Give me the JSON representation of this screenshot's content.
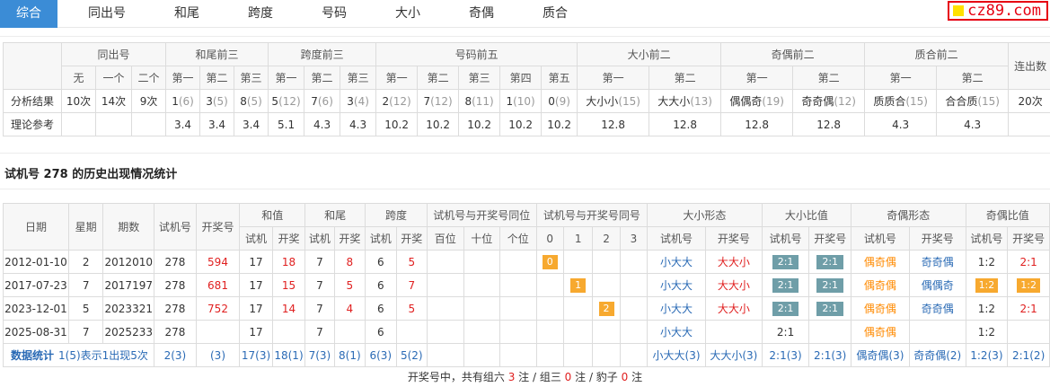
{
  "tabs": [
    "综合",
    "同出号",
    "和尾",
    "跨度",
    "号码",
    "大小",
    "奇偶",
    "质合"
  ],
  "logo": "cz89.com",
  "t1": {
    "groups": [
      "同出号",
      "和尾前三",
      "跨度前三",
      "号码前五",
      "大小前二",
      "奇偶前二",
      "质合前二",
      "连出数"
    ],
    "sub": [
      "无",
      "一个",
      "二个",
      "第一",
      "第二",
      "第三",
      "第一",
      "第二",
      "第三",
      "第一",
      "第二",
      "第三",
      "第四",
      "第五",
      "第一",
      "第二",
      "第一",
      "第二",
      "第一",
      "第二"
    ],
    "row1_label": "分析结果",
    "row1": [
      [
        "10次",
        ""
      ],
      [
        "14次",
        ""
      ],
      [
        "9次",
        ""
      ],
      [
        "1",
        "(6)"
      ],
      [
        "3",
        "(5)"
      ],
      [
        "8",
        "(5)"
      ],
      [
        "5",
        "(12)"
      ],
      [
        "7",
        "(6)"
      ],
      [
        "3",
        "(4)"
      ],
      [
        "2",
        "(12)"
      ],
      [
        "7",
        "(12)"
      ],
      [
        "8",
        "(11)"
      ],
      [
        "1",
        "(10)"
      ],
      [
        "0",
        "(9)"
      ],
      [
        "大小小",
        "(15)"
      ],
      [
        "大大小",
        "(13)"
      ],
      [
        "偶偶奇",
        "(19)"
      ],
      [
        "奇奇偶",
        "(12)"
      ],
      [
        "质质合",
        "(15)"
      ],
      [
        "合合质",
        "(15)"
      ],
      [
        "20次",
        ""
      ]
    ],
    "row2_label": "理论参考",
    "row2": [
      "",
      "",
      "",
      "3.4",
      "3.4",
      "3.4",
      "5.1",
      "4.3",
      "4.3",
      "10.2",
      "10.2",
      "10.2",
      "10.2",
      "10.2",
      "12.8",
      "12.8",
      "12.8",
      "12.8",
      "4.3",
      "4.3",
      ""
    ]
  },
  "section_title": "试机号 278 的历史出现情况统计",
  "t2": {
    "h1": [
      "日期",
      "星期",
      "期数",
      "试机号",
      "开奖号",
      "和值",
      "和尾",
      "跨度",
      "试机号与开奖号同位",
      "试机号与开奖号同号",
      "大小形态",
      "大小比值",
      "奇偶形态",
      "奇偶比值"
    ],
    "h2": [
      "试机",
      "开奖",
      "试机",
      "开奖",
      "试机",
      "开奖",
      "百位",
      "十位",
      "个位",
      "0",
      "1",
      "2",
      "3",
      "试机号",
      "开奖号",
      "试机号",
      "开奖号",
      "试机号",
      "开奖号",
      "试机号",
      "开奖号"
    ],
    "rows": [
      {
        "date": "2012-01-10",
        "week": "2",
        "issue": "2012010",
        "test": "278",
        "draw": "594",
        "sum_t": "17",
        "sum_d": "18",
        "tail_t": "7",
        "tail_d": "8",
        "span_t": "6",
        "span_d": "5",
        "same": "0",
        "same_col": 0,
        "bs_t": "小大大",
        "bs_d": "大大小",
        "bsr_t": "2:1",
        "bsr_d": "2:1",
        "oe_t": "偶奇偶",
        "oe_d": "奇奇偶",
        "oer_t": "1:2",
        "oer_d": "2:1"
      },
      {
        "date": "2017-07-23",
        "week": "7",
        "issue": "2017197",
        "test": "278",
        "draw": "681",
        "sum_t": "17",
        "sum_d": "15",
        "tail_t": "7",
        "tail_d": "5",
        "span_t": "6",
        "span_d": "7",
        "same": "1",
        "same_col": 1,
        "bs_t": "小大大",
        "bs_d": "大大小",
        "bsr_t": "2:1",
        "bsr_d": "2:1",
        "oe_t": "偶奇偶",
        "oe_d": "偶偶奇",
        "oer_t": "1:2",
        "oer_d": "1:2"
      },
      {
        "date": "2023-12-01",
        "week": "5",
        "issue": "2023321",
        "test": "278",
        "draw": "752",
        "sum_t": "17",
        "sum_d": "14",
        "tail_t": "7",
        "tail_d": "4",
        "span_t": "6",
        "span_d": "5",
        "same": "2",
        "same_col": 2,
        "bs_t": "小大大",
        "bs_d": "大大小",
        "bsr_t": "2:1",
        "bsr_d": "2:1",
        "oe_t": "偶奇偶",
        "oe_d": "奇奇偶",
        "oer_t": "1:2",
        "oer_d": "2:1"
      },
      {
        "date": "2025-08-31",
        "week": "7",
        "issue": "2025233",
        "test": "278",
        "draw": "",
        "sum_t": "17",
        "sum_d": "",
        "tail_t": "7",
        "tail_d": "",
        "span_t": "6",
        "span_d": "",
        "same": "",
        "same_col": -1,
        "bs_t": "小大大",
        "bs_d": "",
        "bsr_t": "2:1",
        "bsr_d": "",
        "oe_t": "偶奇偶",
        "oe_d": "",
        "oer_t": "1:2",
        "oer_d": ""
      }
    ],
    "stat": {
      "label": "数据统计",
      "note": "1(5)表示1出现5次",
      "test": "2(3)",
      "draw": "(3)",
      "sum_t": "17(3)",
      "sum_d": "18(1)",
      "tail_t": "7(3)",
      "tail_d": "8(1)",
      "span_t": "6(3)",
      "span_d": "5(2)",
      "bs_t": "小大大(3)",
      "bs_d": "大大小(3)",
      "bsr_t": "2:1(3)",
      "bsr_d": "2:1(3)",
      "oe_t": "偶奇偶(3)",
      "oe_d": "奇奇偶(2)",
      "oer_t": "1:2(3)",
      "oer_d": "2:1(2)"
    }
  },
  "footer": {
    "prefix": "开奖号中，共有组六 ",
    "g6": "3",
    "mid1": " 注 / 组三 ",
    "g3": "0",
    "mid2": " 注 / 豹子 ",
    "bz": "0",
    "suffix": " 注"
  }
}
